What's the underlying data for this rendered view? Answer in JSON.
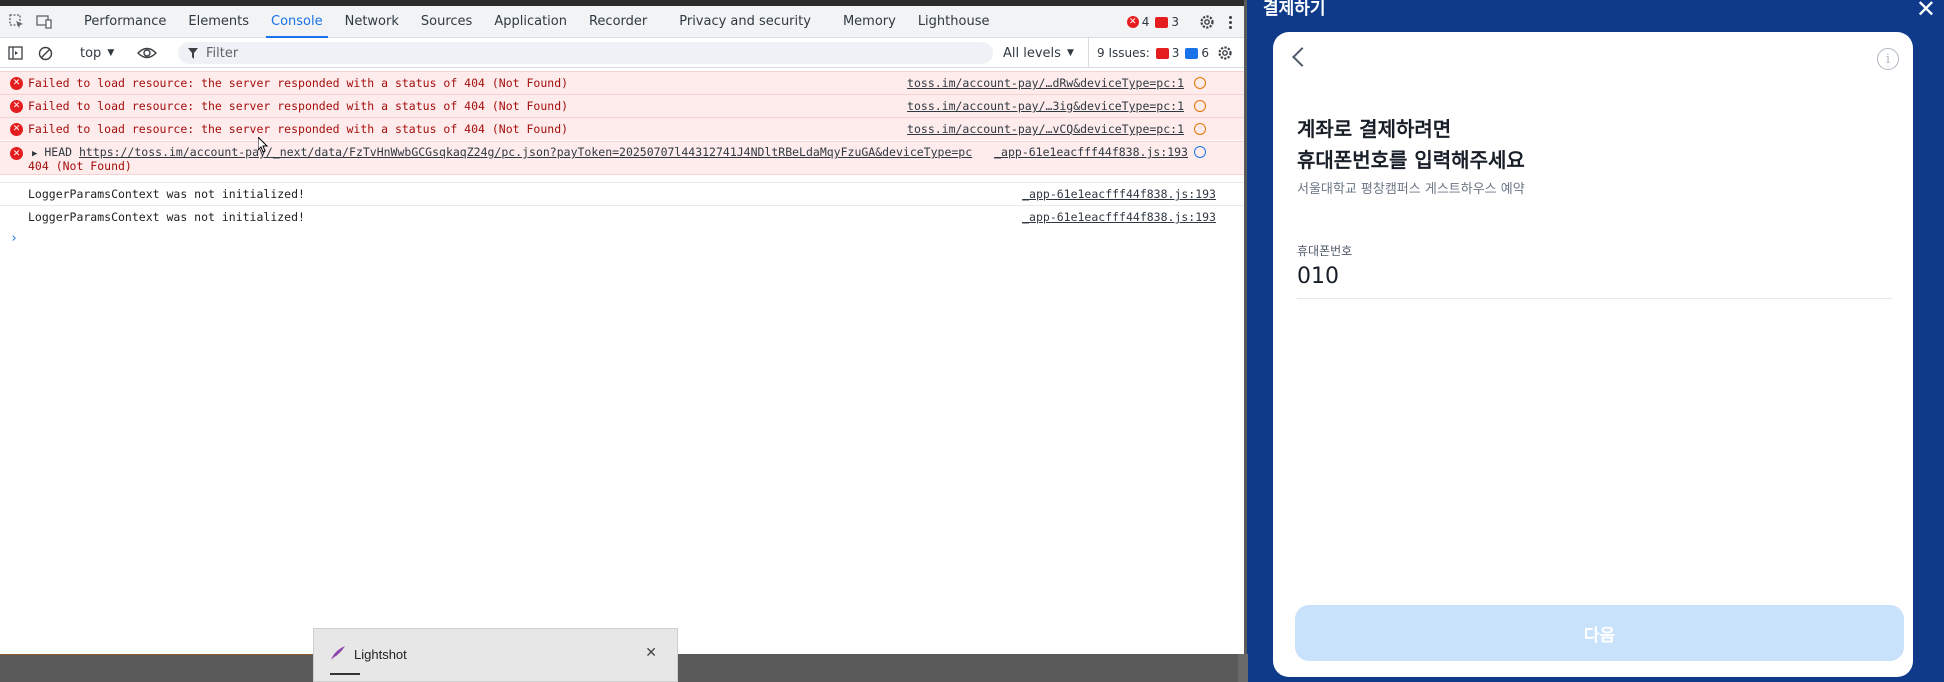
{
  "devtools": {
    "tabs": [
      "Performance",
      "Elements",
      "Console",
      "Network",
      "Sources",
      "Application",
      "Recorder",
      "Privacy and security",
      "Memory",
      "Lighthouse"
    ],
    "active_tab": "Console",
    "error_count": "4",
    "warning_count": "3",
    "context": "top",
    "filter_placeholder": "Filter",
    "levels": "All levels",
    "issues_label": "9 Issues:",
    "issues_errors": "3",
    "issues_info": "6",
    "messages": [
      {
        "text": "Failed to load resource: the server responded with a status of 404 (Not Found)",
        "source": "toss.im/account-pay/…dRw&deviceType=pc:1"
      },
      {
        "text": "Failed to load resource: the server responded with a status of 404 (Not Found)",
        "source": "toss.im/account-pay/…3ig&deviceType=pc:1"
      },
      {
        "text": "Failed to load resource: the server responded with a status of 404 (Not Found)",
        "source": "toss.im/account-pay/…vCQ&deviceType=pc:1"
      }
    ],
    "head_request": {
      "method": "HEAD",
      "url": "https://toss.im/account-pay/_next/data/FzTvHnWwbGCGsqkaqZ24g/pc.json?payToken=20250707l44312741J4NDltRBeLdaMqyFzuGA&deviceType=pc",
      "status": "404 (Not Found)",
      "source": "_app-61e1eacfff44f838.js:193"
    },
    "logs": [
      {
        "text": "LoggerParamsContext was not initialized!",
        "source": "_app-61e1eacfff44f838.js:193"
      },
      {
        "text": "LoggerParamsContext was not initialized!",
        "source": "_app-61e1eacfff44f838.js:193"
      }
    ],
    "prompt": "›"
  },
  "lightshot": {
    "title": "Lightshot",
    "close": "✕"
  },
  "payment": {
    "header_title": "결제하기",
    "close": "✕",
    "heading_line1": "계좌로 결제하려면",
    "heading_line2": "휴대폰번호를 입력해주세요",
    "subtitle": "서울대학교 평창캠퍼스 게스트하우스 예약",
    "field_label": "휴대폰번호",
    "field_value": "010",
    "next_button": "다음",
    "info_icon": "i"
  },
  "colors": {
    "accent": "#1a73e8",
    "error": "#e41e1e",
    "payment_header": "#0f3a8a",
    "next_button_disabled": "#c9e2fb"
  }
}
